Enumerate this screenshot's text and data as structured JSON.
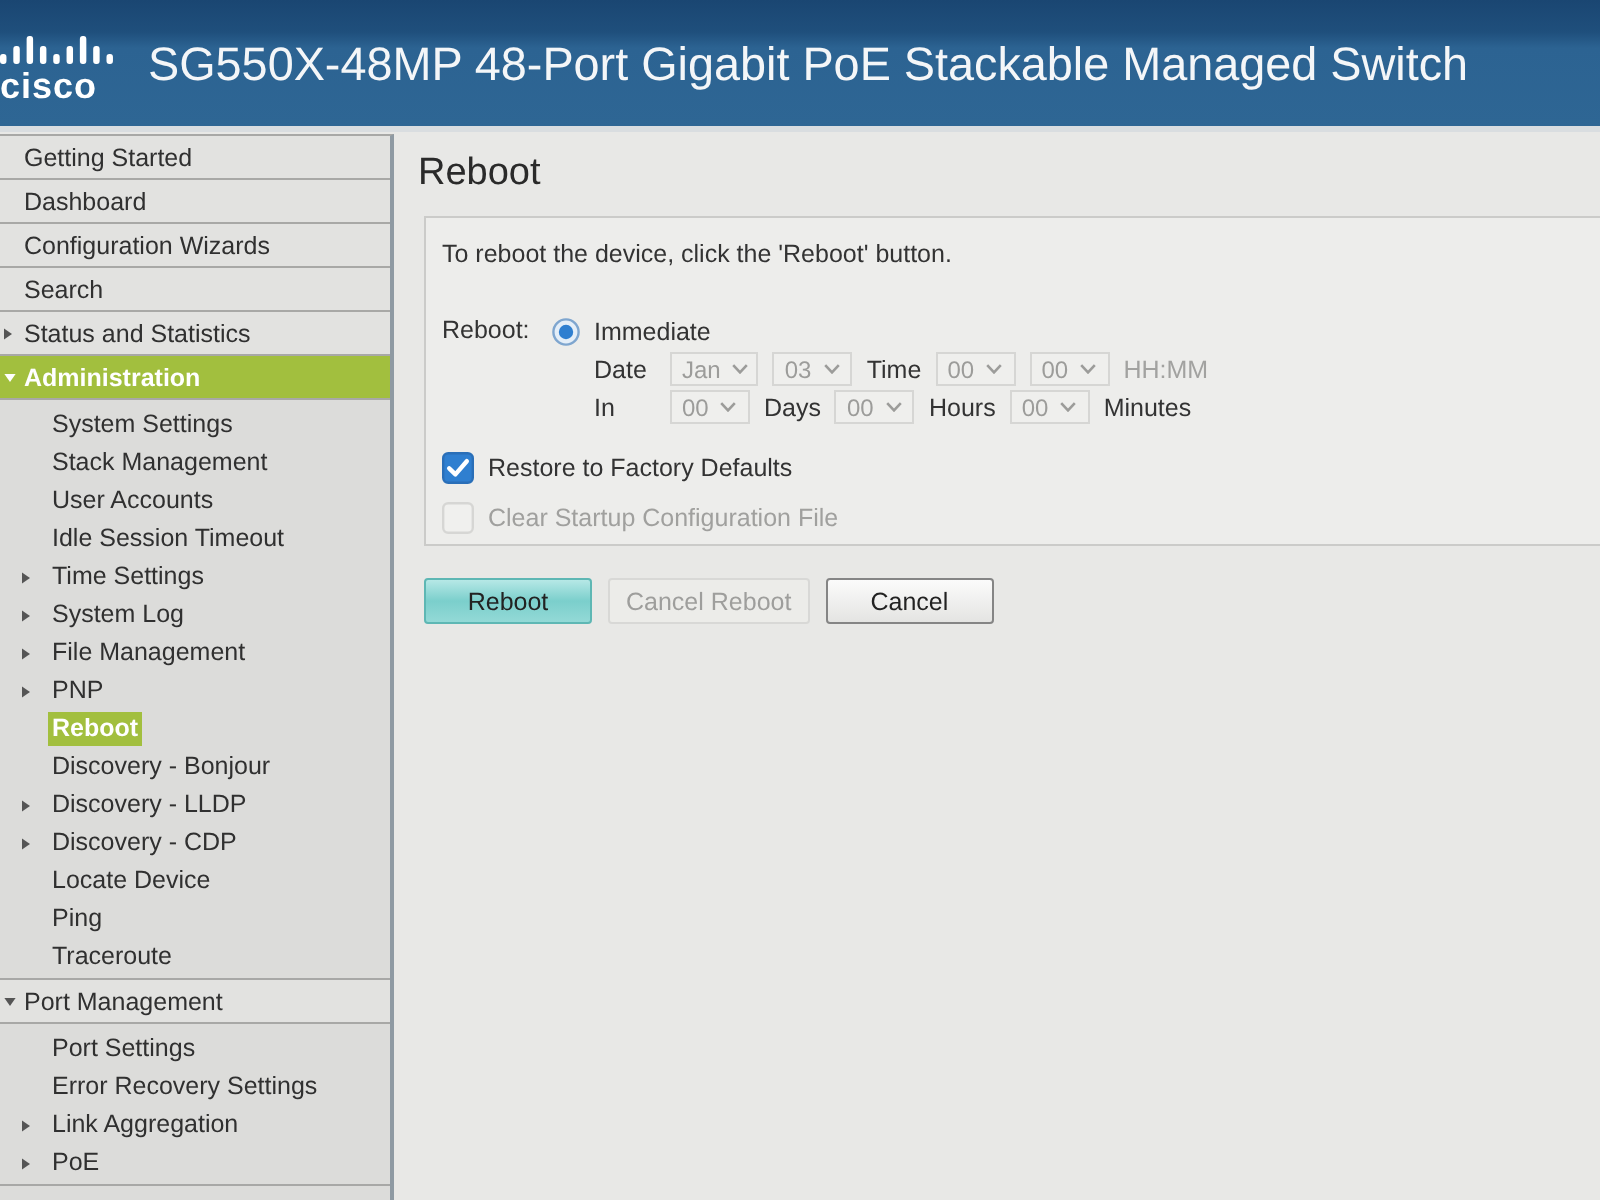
{
  "header": {
    "logo": "cisco",
    "title": "SG550X-48MP 48-Port Gigabit PoE Stackable Managed Switch"
  },
  "sidebar": {
    "items": [
      {
        "label": "Getting Started",
        "kind": "page",
        "selected": false
      },
      {
        "label": "Dashboard",
        "kind": "page",
        "selected": false
      },
      {
        "label": "Configuration Wizards",
        "kind": "page",
        "selected": false
      },
      {
        "label": "Search",
        "kind": "page",
        "selected": false
      },
      {
        "label": "Status and Statistics",
        "kind": "folder",
        "expanded": false,
        "selected": false
      },
      {
        "label": "Administration",
        "kind": "folder",
        "expanded": true,
        "selected": true,
        "children": [
          {
            "label": "System Settings",
            "kind": "page",
            "selected": false
          },
          {
            "label": "Stack Management",
            "kind": "page",
            "selected": false
          },
          {
            "label": "User Accounts",
            "kind": "page",
            "selected": false
          },
          {
            "label": "Idle Session Timeout",
            "kind": "page",
            "selected": false
          },
          {
            "label": "Time Settings",
            "kind": "folder",
            "expanded": false,
            "selected": false
          },
          {
            "label": "System Log",
            "kind": "folder",
            "expanded": false,
            "selected": false
          },
          {
            "label": "File Management",
            "kind": "folder",
            "expanded": false,
            "selected": false
          },
          {
            "label": "PNP",
            "kind": "folder",
            "expanded": false,
            "selected": false
          },
          {
            "label": "Reboot",
            "kind": "page",
            "selected": true
          },
          {
            "label": "Discovery - Bonjour",
            "kind": "page",
            "selected": false
          },
          {
            "label": "Discovery - LLDP",
            "kind": "folder",
            "expanded": false,
            "selected": false
          },
          {
            "label": "Discovery - CDP",
            "kind": "folder",
            "expanded": false,
            "selected": false
          },
          {
            "label": "Locate Device",
            "kind": "page",
            "selected": false
          },
          {
            "label": "Ping",
            "kind": "page",
            "selected": false
          },
          {
            "label": "Traceroute",
            "kind": "page",
            "selected": false
          }
        ]
      },
      {
        "label": "Port Management",
        "kind": "folder",
        "expanded": true,
        "selected": false,
        "children": [
          {
            "label": "Port Settings",
            "kind": "page",
            "selected": false
          },
          {
            "label": "Error Recovery Settings",
            "kind": "page",
            "selected": false
          },
          {
            "label": "Link Aggregation",
            "kind": "folder",
            "expanded": false,
            "selected": false
          },
          {
            "label": "PoE",
            "kind": "folder",
            "expanded": false,
            "selected": false
          }
        ]
      }
    ]
  },
  "page": {
    "title": "Reboot",
    "instruction": "To reboot the device, click the 'Reboot' button.",
    "reboot": {
      "label": "Reboot:",
      "immediate": {
        "label": "Immediate",
        "selected": true
      },
      "schedule": [
        {
          "items": [
            {
              "kind": "label",
              "text": "Date"
            },
            {
              "kind": "select",
              "value": "Jan",
              "disabled": true
            },
            {
              "kind": "select",
              "value": "03",
              "disabled": true
            },
            {
              "kind": "label",
              "text": "Time"
            },
            {
              "kind": "select",
              "value": "00",
              "disabled": true
            },
            {
              "kind": "select",
              "value": "00",
              "disabled": true
            },
            {
              "kind": "hint",
              "text": "HH:MM"
            }
          ]
        },
        {
          "items": [
            {
              "kind": "label",
              "text": "In"
            },
            {
              "kind": "select",
              "value": "00",
              "disabled": true
            },
            {
              "kind": "label",
              "text": "Days"
            },
            {
              "kind": "select",
              "value": "00",
              "disabled": true
            },
            {
              "kind": "label",
              "text": "Hours"
            },
            {
              "kind": "select",
              "value": "00",
              "disabled": true
            },
            {
              "kind": "label",
              "text": "Minutes"
            }
          ]
        }
      ]
    },
    "checkboxes": [
      {
        "label": "Restore to Factory Defaults",
        "checked": true,
        "disabled": false
      },
      {
        "label": "Clear Startup Configuration File",
        "checked": false,
        "disabled": true
      }
    ],
    "buttons": [
      {
        "label": "Reboot",
        "kind": "primary",
        "disabled": false
      },
      {
        "label": "Cancel Reboot",
        "kind": "secondary",
        "disabled": true
      },
      {
        "label": "Cancel",
        "kind": "secondary",
        "disabled": false
      }
    ]
  }
}
